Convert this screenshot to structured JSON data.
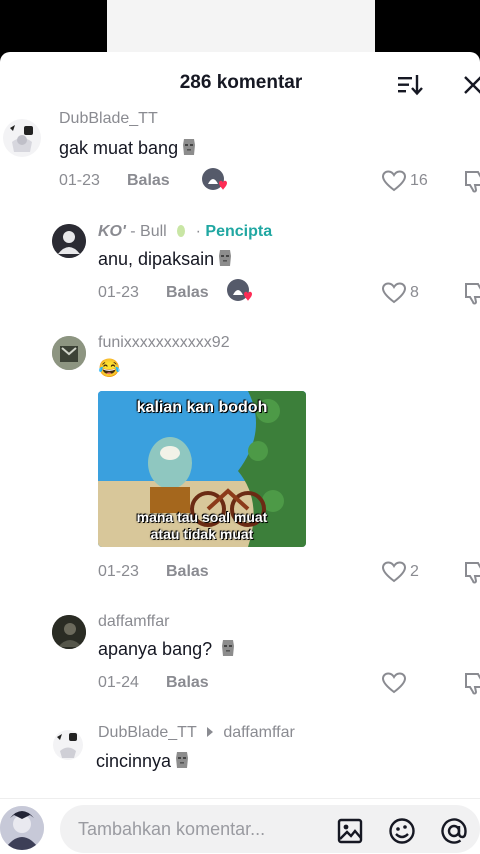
{
  "header": {
    "title": "286 komentar"
  },
  "reply_label": "Balas",
  "comments": [
    {
      "username": "DubBlade_TT",
      "text": "gak muat bang",
      "date": "01-23",
      "likes": "16"
    },
    {
      "username": "KO'",
      "username_suffix": "- Bull",
      "creator_label": "Pencipta",
      "text": "anu, dipaksain",
      "date": "01-23",
      "likes": "8"
    },
    {
      "username": "funixxxxxxxxxxx92",
      "text": "😂",
      "date": "01-23",
      "likes": "2",
      "meme": {
        "top_caption": "kalian kan bodoh",
        "bottom_caption_1": "mana tau soal muat",
        "bottom_caption_2": "atau tidak muat"
      }
    },
    {
      "username": "daffamffar",
      "text": "apanya bang?",
      "date": "01-24",
      "likes": ""
    },
    {
      "username": "DubBlade_TT",
      "reply_to": "daffamffar",
      "text": "cincinnya"
    }
  ],
  "composer": {
    "placeholder": "Tambahkan komentar..."
  },
  "colors": {
    "accent_creator": "#20a7a2",
    "heart_red": "#fe2c55",
    "text_primary": "#161823",
    "text_secondary": "#8a8b91"
  }
}
